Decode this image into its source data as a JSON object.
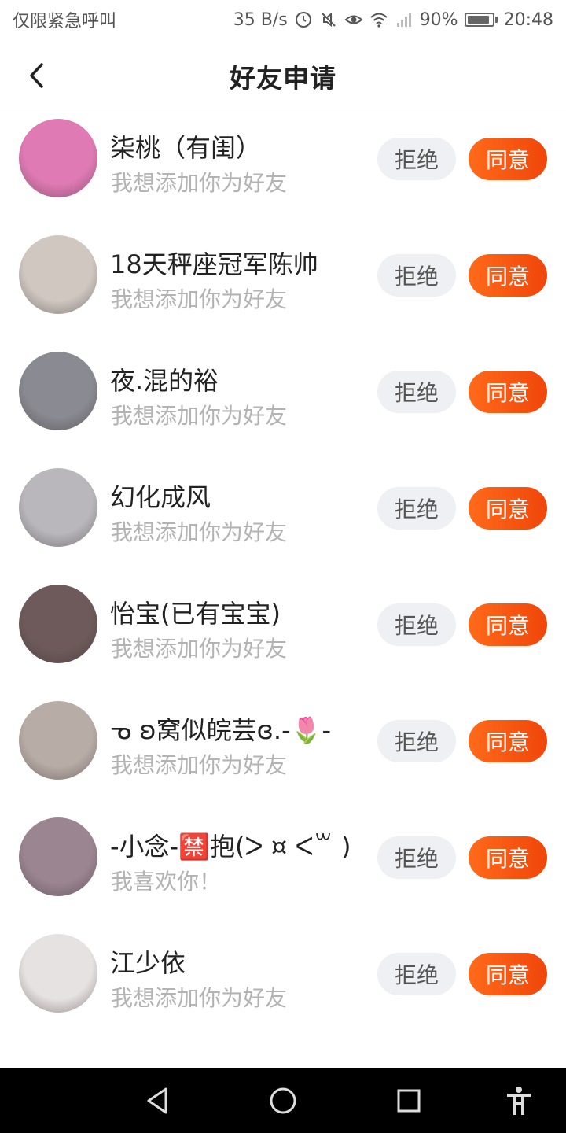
{
  "status_bar": {
    "carrier_text": "仅限紧急呼叫",
    "net_speed": "35 B/s",
    "battery_percent": "90%",
    "battery_level": 0.9,
    "time": "20:48",
    "icons": [
      "data-saver-icon",
      "mute-icon",
      "eye-icon",
      "wifi-icon",
      "signal-icon",
      "battery-icon"
    ]
  },
  "header": {
    "title": "好友申请",
    "back_icon": "chevron-left-icon"
  },
  "requests": [
    {
      "name": "柒桃（有闺）",
      "message": "我想添加你为好友",
      "reject": "拒绝",
      "accept": "同意",
      "avatar_color": "#e07ab4"
    },
    {
      "name": "18天秤座冠军陈帅",
      "message": "我想添加你为好友",
      "reject": "拒绝",
      "accept": "同意",
      "avatar_color": "#cfc7c0"
    },
    {
      "name": "夜.混的裕",
      "message": "我想添加你为好友",
      "reject": "拒绝",
      "accept": "同意",
      "avatar_color": "#8a8a92"
    },
    {
      "name": "幻化成风",
      "message": "我想添加你为好友",
      "reject": "拒绝",
      "accept": "同意",
      "avatar_color": "#b9b7bc"
    },
    {
      "name": "怡宝(已有宝宝)",
      "message": "我想添加你为好友",
      "reject": "拒绝",
      "accept": "同意",
      "avatar_color": "#6e5a5a"
    },
    {
      "name": "ᓀ ʚ窝似皖芸ɞ.-🌷-",
      "message": "我想添加你为好友",
      "reject": "拒绝",
      "accept": "同意",
      "avatar_color": "#b8aca6"
    },
    {
      "name": "-小念-🈲抱(ᐳ ¤ ᐸ꒳ )",
      "message": "我喜欢你！",
      "reject": "拒绝",
      "accept": "同意",
      "avatar_color": "#9b8590"
    },
    {
      "name": "江少依",
      "message": "我想添加你为好友",
      "reject": "拒绝",
      "accept": "同意",
      "avatar_color": "#e7e2e2"
    }
  ],
  "navbar": {
    "icons": [
      "back-triangle-icon",
      "home-circle-icon",
      "recents-square-icon",
      "accessibility-icon"
    ]
  },
  "colors": {
    "accept_gradient_start": "#ff6a1a",
    "accept_gradient_end": "#f0460a",
    "reject_bg": "#eef0f4",
    "secondary_text": "#b3b3b3"
  }
}
